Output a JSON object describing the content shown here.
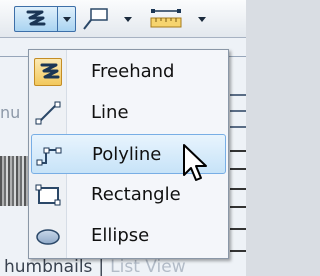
{
  "toolbar": {
    "draw_tool": {
      "icon": "freehand-icon",
      "dropdown_icon": "chevron-down-icon"
    },
    "shape_tool": {
      "icon": "shape-icon",
      "dropdown_icon": "chevron-down-icon"
    },
    "measure_tool": {
      "icon": "ruler-icon",
      "dropdown_icon": "chevron-down-icon"
    }
  },
  "background": {
    "partial_text": "nu",
    "footer": {
      "tab_left": "humbnails",
      "separator": "|",
      "tab_right": "List View"
    }
  },
  "menu": {
    "items": [
      {
        "label": "Freehand",
        "icon": "freehand-icon",
        "checked": true
      },
      {
        "label": "Line",
        "icon": "line-icon"
      },
      {
        "label": "Polyline",
        "icon": "polyline-icon",
        "hovered": true
      },
      {
        "label": "Rectangle",
        "icon": "rectangle-icon"
      },
      {
        "label": "Ellipse",
        "icon": "ellipse-icon"
      }
    ]
  },
  "colors": {
    "accent": "#3d6fa8",
    "hover_bg": "#c7e3f8",
    "checked_bg": "#f2c85c",
    "icon_dark": "#1b3655"
  }
}
